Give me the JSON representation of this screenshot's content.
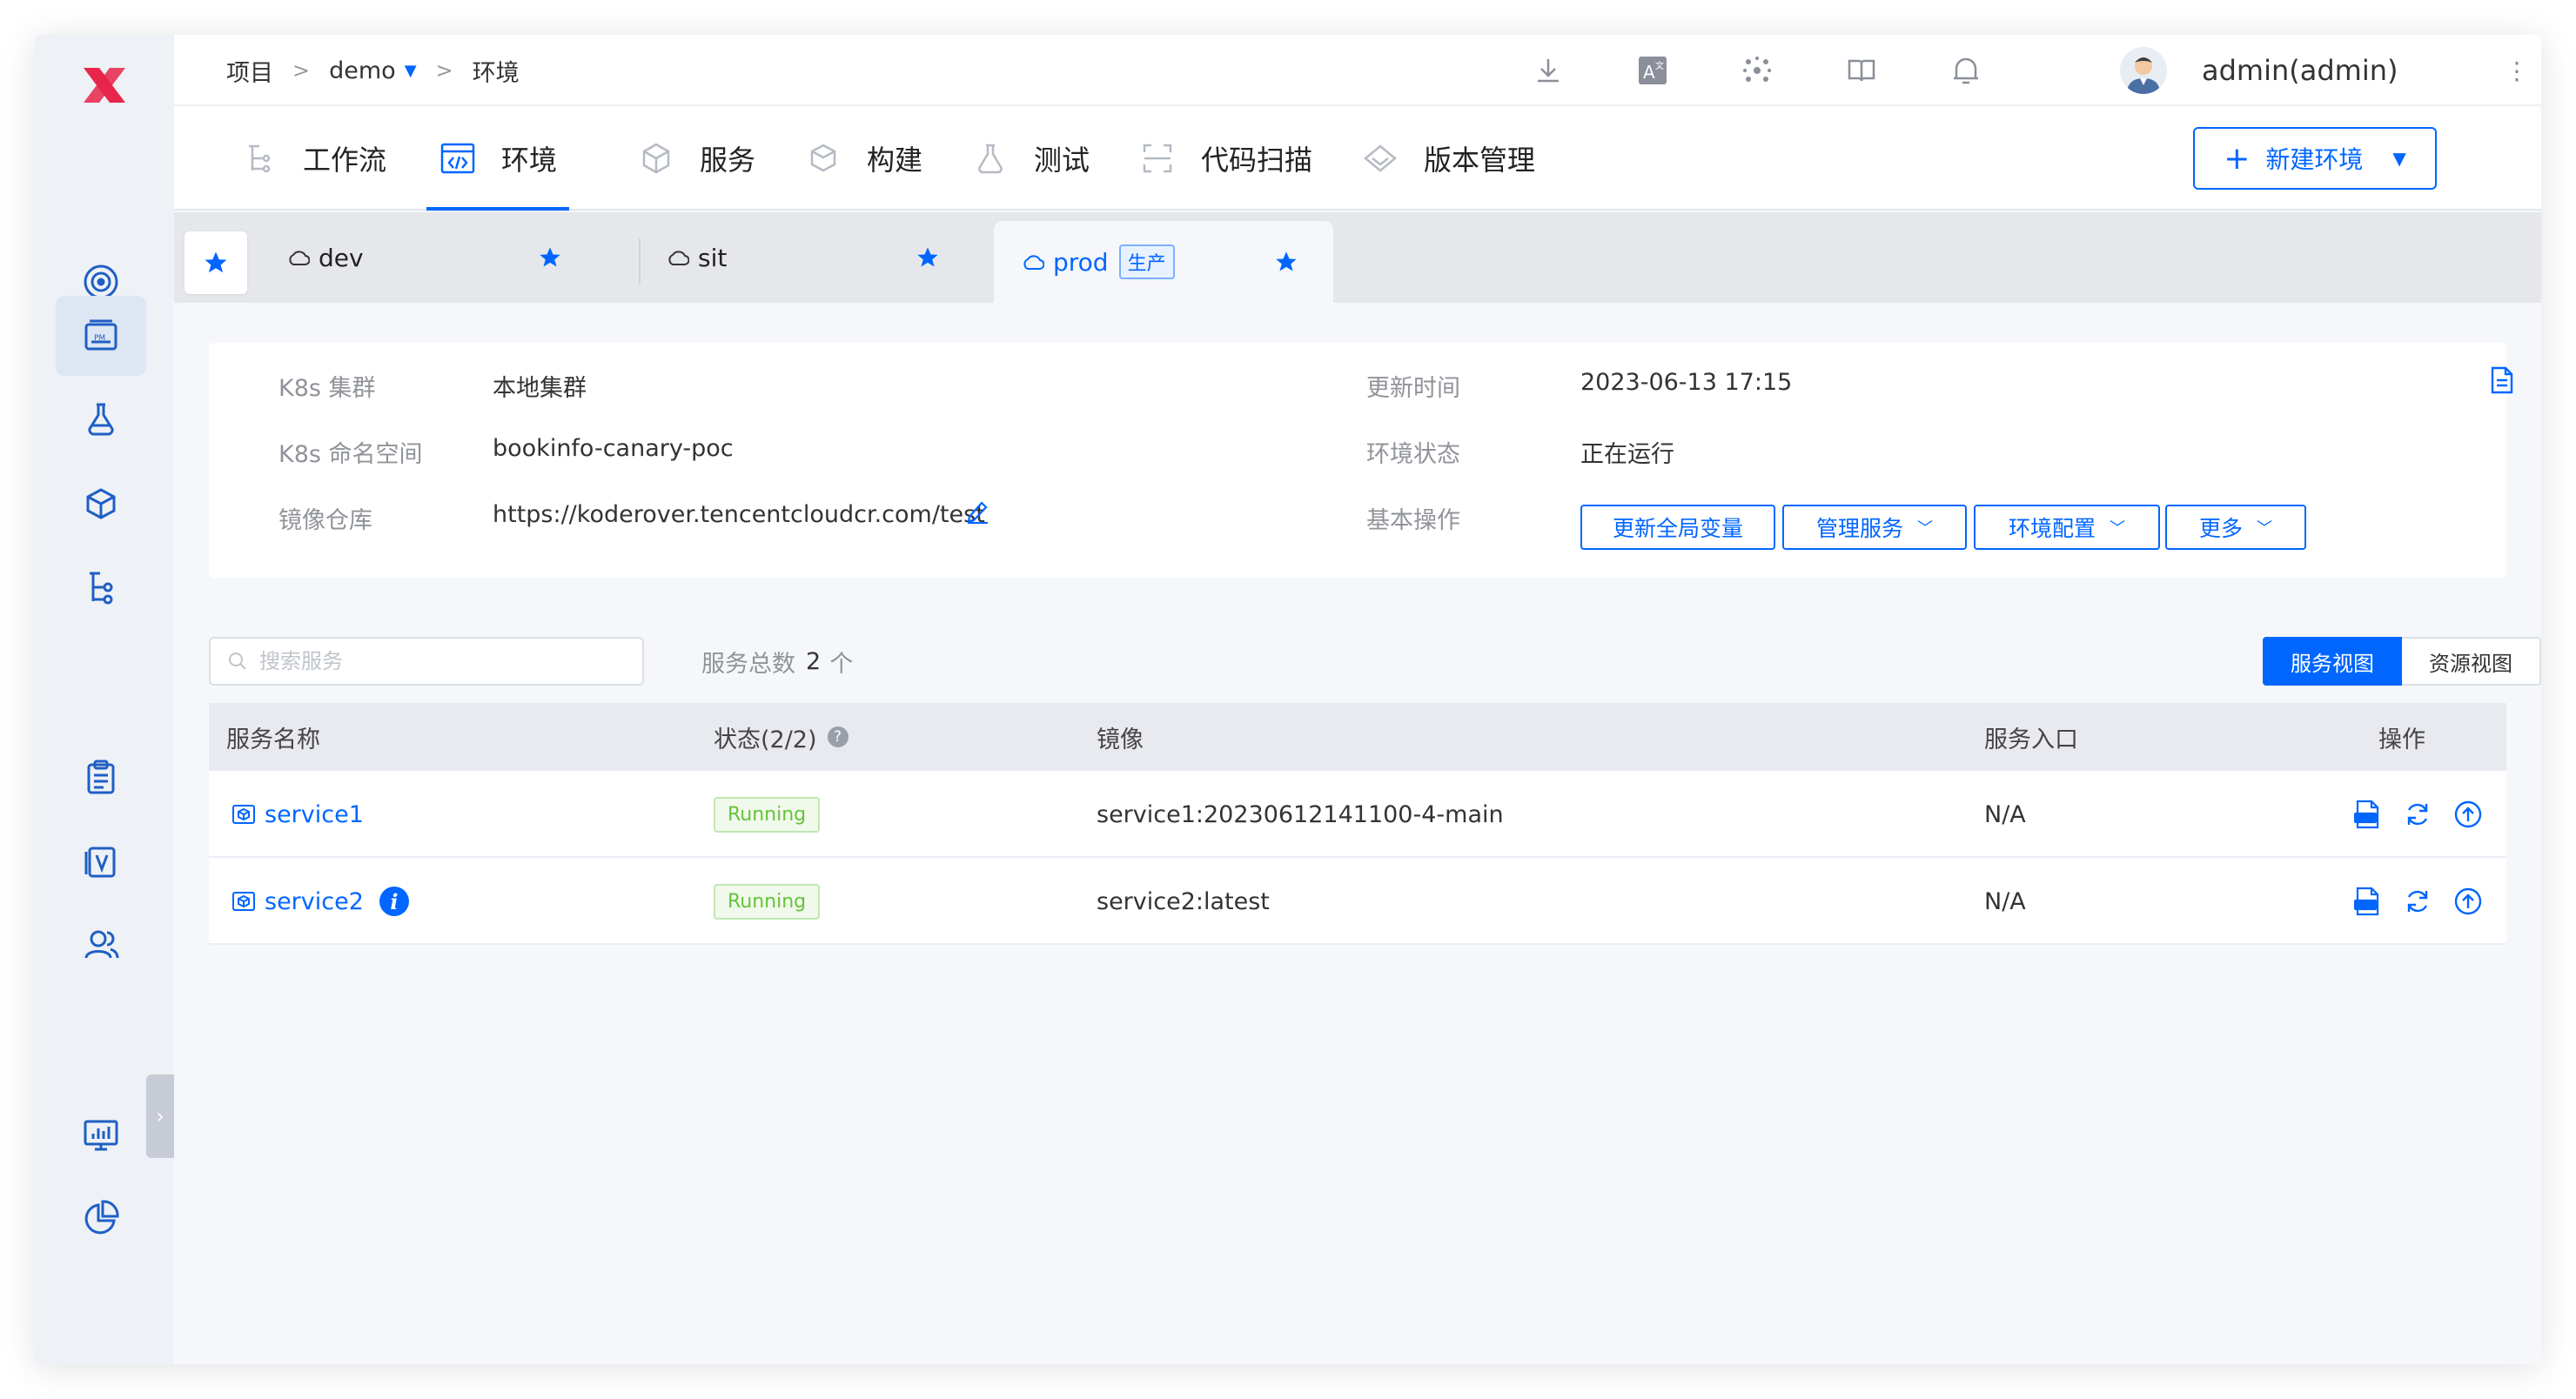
{
  "breadcrumb": {
    "project": "项目",
    "sep1": ">",
    "demo": "demo",
    "sep2": ">",
    "current": "环境"
  },
  "user": {
    "name": "admin(admin)"
  },
  "nav": {
    "tabs": [
      {
        "label": "工作流",
        "icon": "workflow-icon"
      },
      {
        "label": "环境",
        "icon": "environment-icon",
        "active": true
      },
      {
        "label": "服务",
        "icon": "service-icon"
      },
      {
        "label": "构建",
        "icon": "build-icon"
      },
      {
        "label": "测试",
        "icon": "test-icon"
      },
      {
        "label": "代码扫描",
        "icon": "scan-icon"
      },
      {
        "label": "版本管理",
        "icon": "version-icon"
      }
    ],
    "new_env_label": "新建环境"
  },
  "env_tabs": [
    {
      "name": "dev"
    },
    {
      "name": "sit"
    },
    {
      "name": "prod",
      "badge": "生产",
      "active": true
    }
  ],
  "info": {
    "cluster_label": "K8s 集群",
    "cluster_value": "本地集群",
    "namespace_label": "K8s 命名空间",
    "namespace_value": "bookinfo-canary-poc",
    "registry_label": "镜像仓库",
    "registry_value": "https://koderover.tencentcloudcr.com/test",
    "updated_label": "更新时间",
    "updated_value": "2023-06-13 17:15",
    "status_label": "环境状态",
    "status_value": "正在运行",
    "ops_label": "基本操作",
    "ops": {
      "update_vars": "更新全局变量",
      "manage_services": "管理服务",
      "env_config": "环境配置",
      "more": "更多"
    }
  },
  "toolbar": {
    "search_placeholder": "搜索服务",
    "count_label": "服务总数",
    "count_value": "2",
    "count_unit": "个",
    "service_view": "服务视图",
    "resource_view": "资源视图"
  },
  "table": {
    "headers": {
      "name": "服务名称",
      "status": "状态(2/2)",
      "image": "镜像",
      "entry": "服务入口",
      "actions": "操作"
    },
    "rows": [
      {
        "name": "service1",
        "status": "Running",
        "image": "service1:20230612141100-4-main",
        "entry": "N/A"
      },
      {
        "name": "service2",
        "status": "Running",
        "image": "service2:latest",
        "entry": "N/A",
        "info": "i"
      }
    ]
  },
  "colors": {
    "accent": "#0066ff",
    "logo": "#e8254a",
    "running": "#67c23a"
  }
}
